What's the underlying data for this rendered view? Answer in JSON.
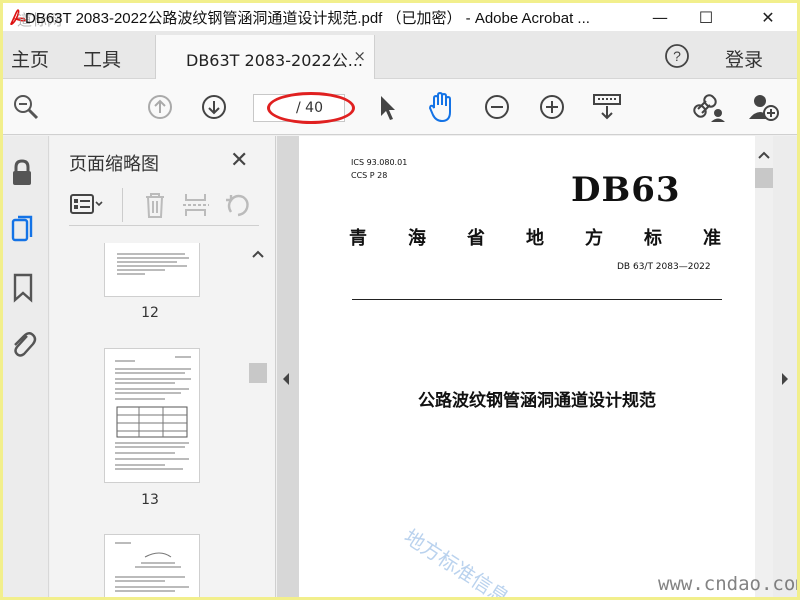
{
  "window": {
    "title": "DB63T 2083-2022公路波纹钢管涵洞通道设计规范.pdf （已加密） - Adobe Acrobat ...",
    "logo_text": "道标网",
    "minimize": "—",
    "maximize": "☐",
    "close": "✕"
  },
  "tabs": {
    "home": "主页",
    "tools": "工具",
    "document": "DB63T 2083-2022公...",
    "close": "×",
    "signin": "登录"
  },
  "toolbar": {
    "page_total": "/ 40"
  },
  "panel": {
    "title": "页面缩略图",
    "close": "✕",
    "thumbs": [
      {
        "number": "12"
      },
      {
        "number": "13"
      }
    ]
  },
  "document": {
    "ics": "ICS  93.080.01",
    "ccs": "CCS  P 28",
    "code": "DB63",
    "province_chars": [
      "青",
      "海",
      "省",
      "地",
      "方",
      "标",
      "准"
    ],
    "standard_no": "DB 63/T 2083—2022",
    "title": "公路波纹钢管涵洞通道设计规范"
  },
  "watermarks": {
    "diagonal": "地方标准信息",
    "site": "www.cndao.com"
  },
  "colors": {
    "accent_blue": "#1473e6",
    "highlight_oval": "#e02020",
    "frame_yellow": "#f2ef8c"
  }
}
